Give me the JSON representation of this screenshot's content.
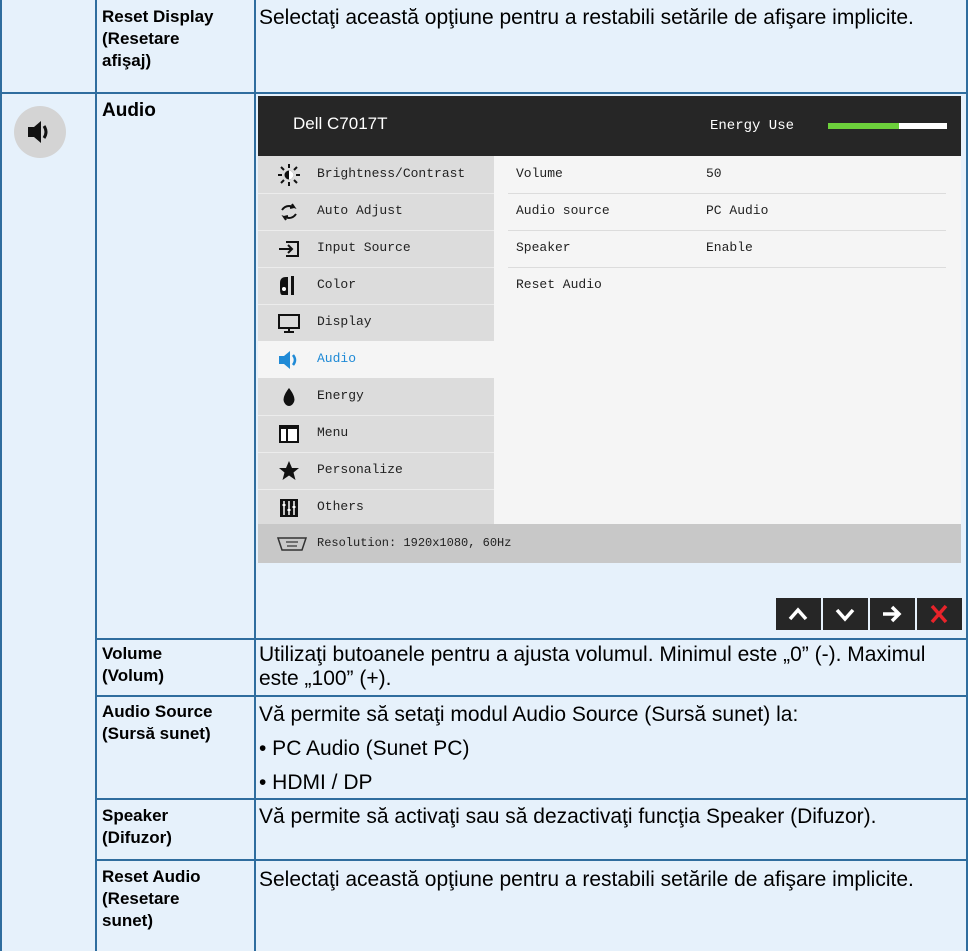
{
  "rows": {
    "reset_display": {
      "name_line1": "Reset Display",
      "name_line2": "(Resetare",
      "name_line3": "afişaj)",
      "desc": "Selectaţi această opţiune pentru a restabili setările de afişare implicite."
    },
    "audio_section": {
      "name": "Audio",
      "icon": "speaker-icon"
    },
    "volume": {
      "name_line1": "Volume",
      "name_line2": "(Volum)",
      "desc": "Utilizaţi butoanele pentru a ajusta volumul. Minimul este „0” (-). Maximul este „100” (+)."
    },
    "audio_source": {
      "name_line1": "Audio Source",
      "name_line2": "(Sursă sunet)",
      "desc_line1": "Vă permite să setaţi modul Audio Source (Sursă sunet) la:",
      "desc_line2": "• PC Audio (Sunet PC)",
      "desc_line3": "• HDMI / DP"
    },
    "speaker": {
      "name_line1": "Speaker",
      "name_line2": "(Difuzor)",
      "desc": "Vă permite să activaţi sau să dezactivaţi funcţia Speaker (Difuzor)."
    },
    "reset_audio": {
      "name_line1": "Reset Audio",
      "name_line2": "(Resetare",
      "name_line3": "sunet)",
      "desc": "Selectaţi această opţiune pentru a restabili setările de afişare implicite."
    }
  },
  "osd": {
    "title": "Dell C7017T",
    "energy_label": "Energy Use",
    "energy_level": 0.6,
    "menu": [
      {
        "label": "Brightness/Contrast",
        "icon": "brightness-icon"
      },
      {
        "label": "Auto Adjust",
        "icon": "auto-adjust-icon"
      },
      {
        "label": "Input Source",
        "icon": "input-source-icon"
      },
      {
        "label": "Color",
        "icon": "color-icon"
      },
      {
        "label": "Display",
        "icon": "display-icon"
      },
      {
        "label": "Audio",
        "icon": "audio-icon",
        "active": true
      },
      {
        "label": "Energy",
        "icon": "energy-icon"
      },
      {
        "label": "Menu",
        "icon": "menu-icon"
      },
      {
        "label": "Personalize",
        "icon": "star-icon"
      },
      {
        "label": "Others",
        "icon": "others-icon"
      }
    ],
    "settings": [
      {
        "label": "Volume",
        "value": "50"
      },
      {
        "label": "Audio source",
        "value": "PC Audio"
      },
      {
        "label": "Speaker",
        "value": "Enable"
      },
      {
        "label": "Reset Audio",
        "value": ""
      }
    ],
    "resolution": "Resolution: 1920x1080, 60Hz",
    "nav_buttons": [
      "up-arrow-icon",
      "down-arrow-icon",
      "right-arrow-icon",
      "close-icon"
    ],
    "accent_color": "#1f8ad6",
    "close_color": "#e8232a"
  }
}
